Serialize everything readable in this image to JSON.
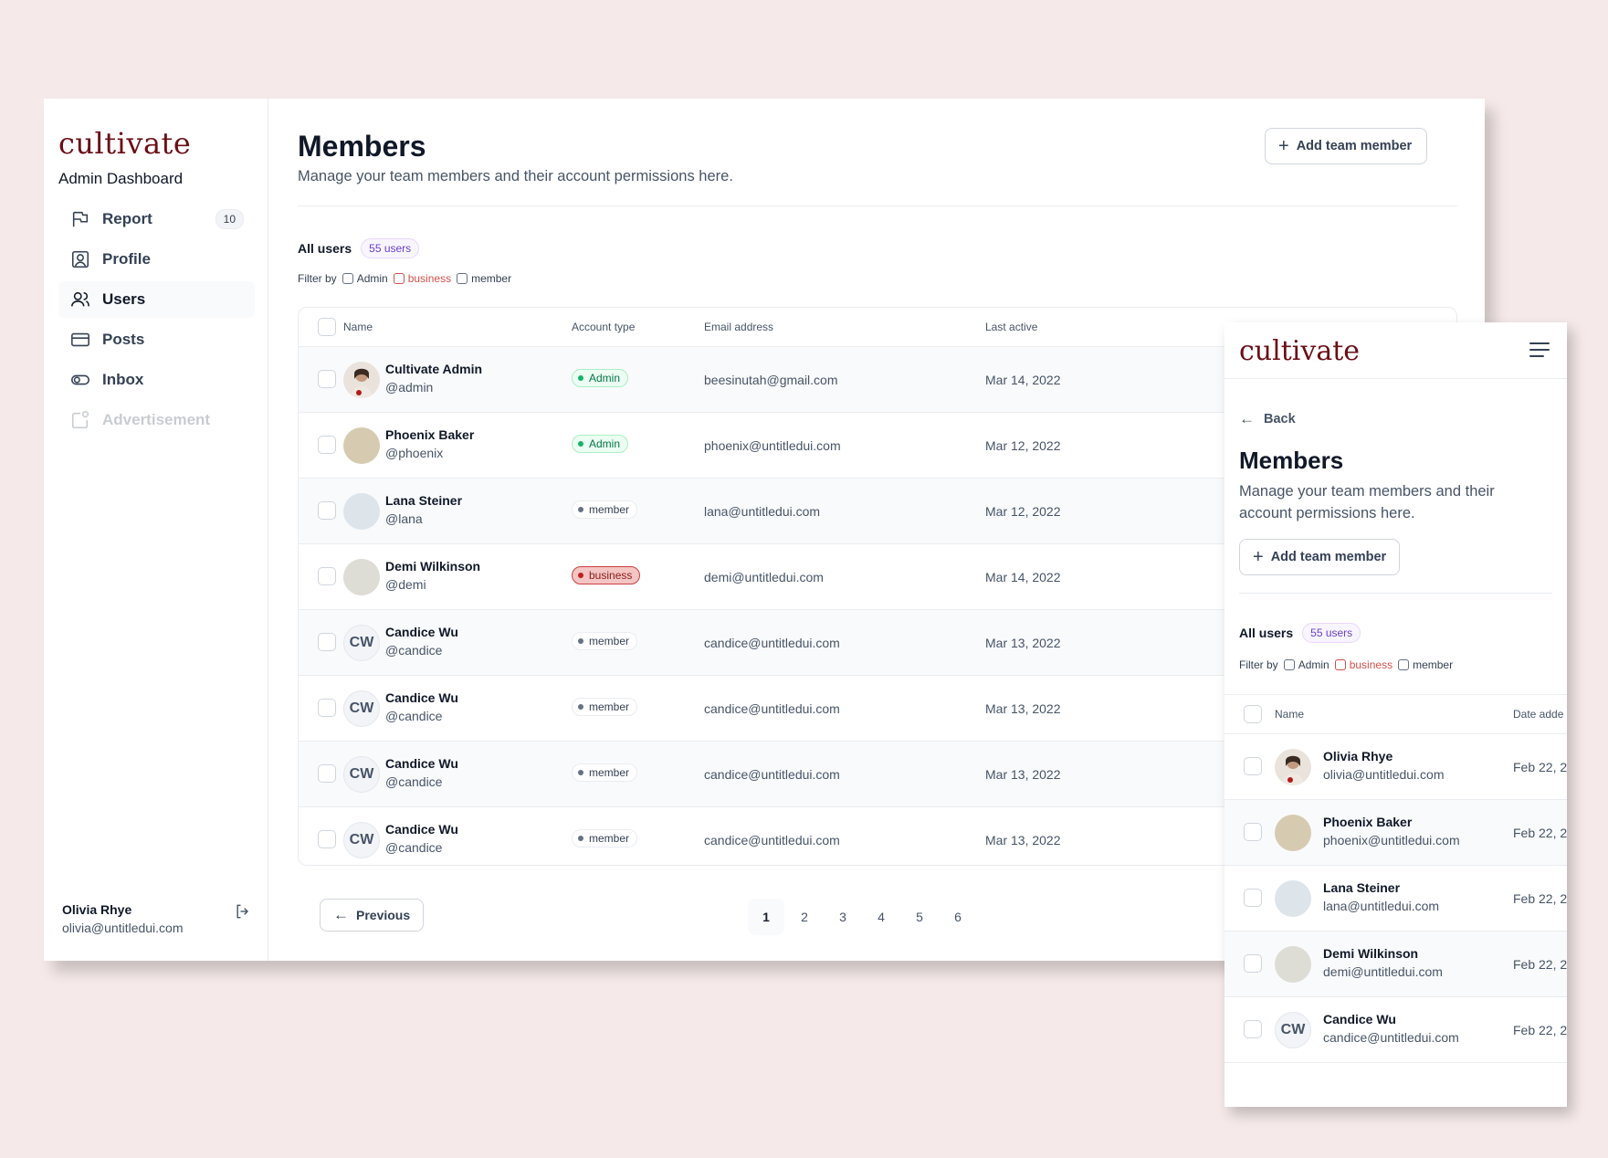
{
  "desktop": {
    "logo": "cultivate",
    "subtitle": "Admin Dashboard",
    "nav": [
      {
        "label": "Report",
        "icon": "flag-icon",
        "badge": "10"
      },
      {
        "label": "Profile",
        "icon": "profile-icon"
      },
      {
        "label": "Users",
        "icon": "users-icon"
      },
      {
        "label": "Posts",
        "icon": "card-icon"
      },
      {
        "label": "Inbox",
        "icon": "toggle-icon"
      },
      {
        "label": "Advertisement",
        "icon": "advertisement-icon"
      }
    ],
    "user": {
      "name": "Olivia Rhye",
      "email": "olivia@untitledui.com"
    },
    "header": {
      "title": "Members",
      "description": "Manage your team members and their account permissions here.",
      "add_button": "Add team member"
    },
    "all_users_label": "All users",
    "users_count": "55 users",
    "filter": {
      "label": "Filter by",
      "options": [
        "Admin",
        "business",
        "member"
      ]
    },
    "columns": [
      "Name",
      "Account type",
      "Email address",
      "Last active"
    ],
    "rows": [
      {
        "name": "Cultivate Admin",
        "handle": "@admin",
        "type": "Admin",
        "email": "beesinutah@gmail.com",
        "last_active": "Mar 14, 2022",
        "initials": ""
      },
      {
        "name": "Phoenix Baker",
        "handle": "@phoenix",
        "type": "Admin",
        "email": "phoenix@untitledui.com",
        "last_active": "Mar 12, 2022",
        "initials": ""
      },
      {
        "name": "Lana Steiner",
        "handle": "@lana",
        "type": "member",
        "email": "lana@untitledui.com",
        "last_active": "Mar 12, 2022",
        "initials": ""
      },
      {
        "name": "Demi Wilkinson",
        "handle": "@demi",
        "type": "business",
        "email": "demi@untitledui.com",
        "last_active": "Mar 14, 2022",
        "initials": ""
      },
      {
        "name": "Candice Wu",
        "handle": "@candice",
        "type": "member",
        "email": "candice@untitledui.com",
        "last_active": "Mar 13, 2022",
        "initials": "CW"
      },
      {
        "name": "Candice Wu",
        "handle": "@candice",
        "type": "member",
        "email": "candice@untitledui.com",
        "last_active": "Mar 13, 2022",
        "initials": "CW"
      },
      {
        "name": "Candice Wu",
        "handle": "@candice",
        "type": "member",
        "email": "candice@untitledui.com",
        "last_active": "Mar 13, 2022",
        "initials": "CW"
      },
      {
        "name": "Candice Wu",
        "handle": "@candice",
        "type": "member",
        "email": "candice@untitledui.com",
        "last_active": "Mar 13, 2022",
        "initials": "CW"
      }
    ],
    "pagination": {
      "previous": "Previous",
      "pages": [
        "1",
        "2",
        "3",
        "4",
        "5",
        "6"
      ],
      "current": "1"
    }
  },
  "mobile": {
    "logo": "cultivate",
    "back": "Back",
    "title": "Members",
    "description": "Manage your team members and their account permissions here.",
    "add_button": "Add team member",
    "all_users_label": "All users",
    "users_count": "55 users",
    "filter": {
      "label": "Filter by",
      "options": [
        "Admin",
        "business",
        "member"
      ]
    },
    "columns": [
      "Name",
      "Date adde"
    ],
    "rows": [
      {
        "name": "Olivia Rhye",
        "email": "olivia@untitledui.com",
        "date": "Feb 22, 2",
        "initials": ""
      },
      {
        "name": "Phoenix Baker",
        "email": "phoenix@untitledui.com",
        "date": "Feb 22, 2",
        "initials": ""
      },
      {
        "name": "Lana Steiner",
        "email": "lana@untitledui.com",
        "date": "Feb 22, 2",
        "initials": ""
      },
      {
        "name": "Demi Wilkinson",
        "email": "demi@untitledui.com",
        "date": "Feb 22, 2",
        "initials": ""
      },
      {
        "name": "Candice Wu",
        "email": "candice@untitledui.com",
        "date": "Feb 22, 2",
        "initials": "CW"
      }
    ]
  },
  "colors": {
    "brand": "#6b0f18",
    "admin_badge": "#067647",
    "business_badge": "#c21f1f",
    "background": "#f5e9e9"
  }
}
